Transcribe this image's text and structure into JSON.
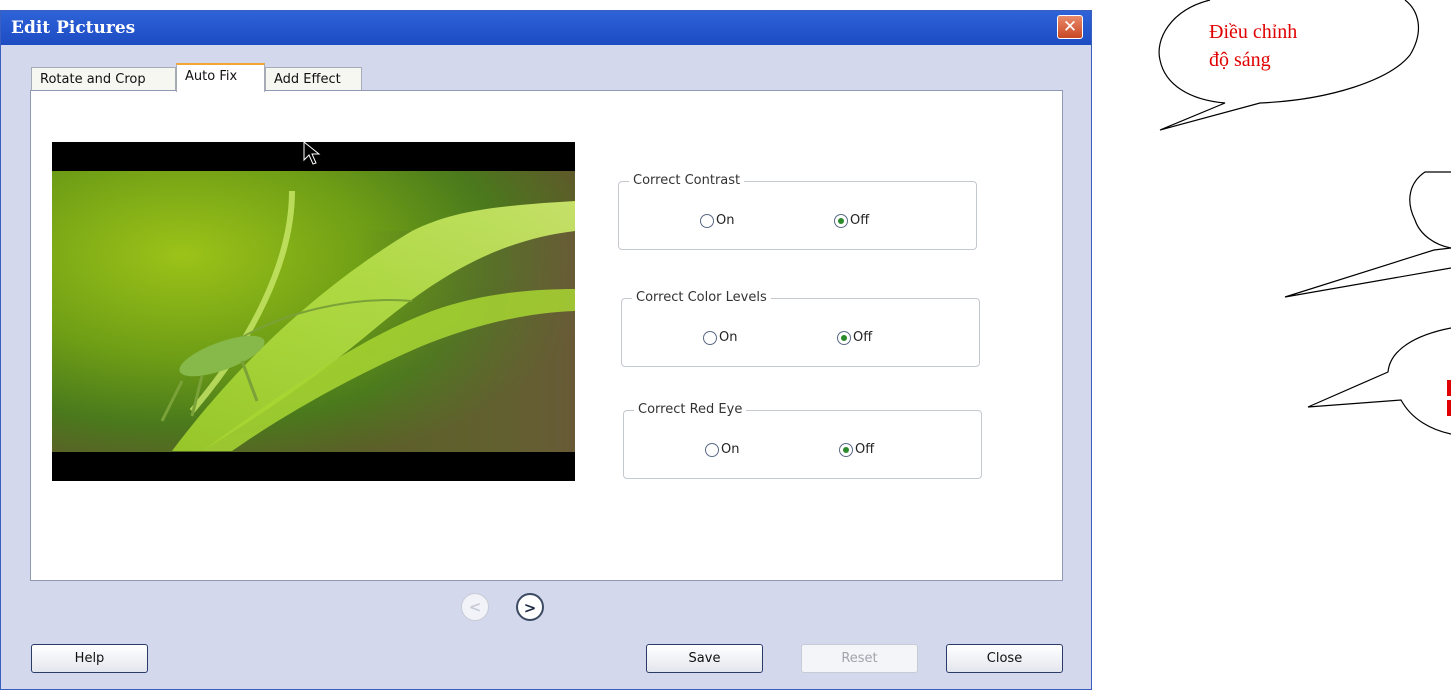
{
  "window": {
    "title": "Edit Pictures",
    "close_symbol": "✕"
  },
  "tabs": [
    {
      "label": "Rotate and Crop",
      "active": false
    },
    {
      "label": "Auto Fix",
      "active": true
    },
    {
      "label": "Add Effect",
      "active": false
    }
  ],
  "options": [
    {
      "legend": "Correct Contrast",
      "on_label": "On",
      "off_label": "Off",
      "selected": "Off"
    },
    {
      "legend": "Correct Color Levels",
      "on_label": "On",
      "off_label": "Off",
      "selected": "Off"
    },
    {
      "legend": "Correct Red Eye",
      "on_label": "On",
      "off_label": "Off",
      "selected": "Off"
    }
  ],
  "navigation": {
    "prev_symbol": "<",
    "next_symbol": ">",
    "prev_enabled": false,
    "next_enabled": true
  },
  "buttons": {
    "help": "Help",
    "save": "Save",
    "reset": "Reset",
    "close": "Close"
  },
  "callouts": [
    {
      "line1": "Điều chỉnh",
      "line2": "độ sáng"
    }
  ],
  "colors": {
    "titlebar": "#2659d0",
    "callout_text": "#e00000",
    "active_tab_accent": "#f5a532"
  }
}
